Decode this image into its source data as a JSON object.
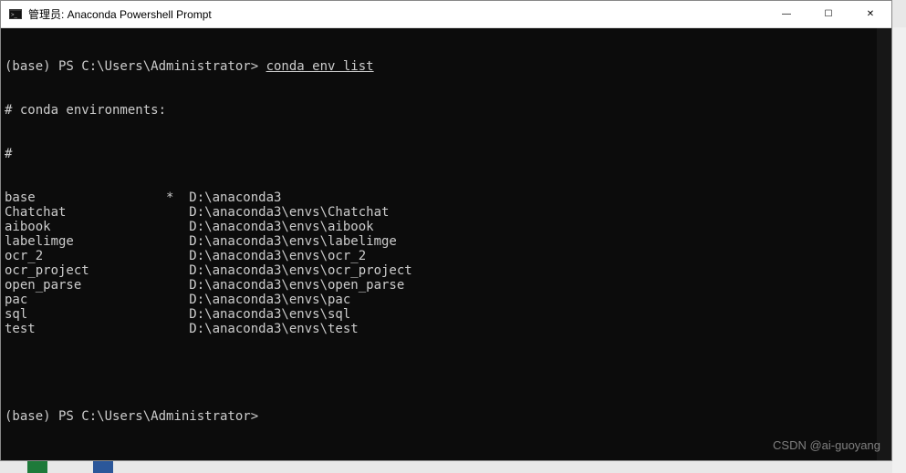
{
  "window": {
    "title": "管理员: Anaconda Powershell Prompt",
    "controls": {
      "minimize": "—",
      "maximize": "☐",
      "close": "✕"
    }
  },
  "terminal": {
    "prompt1_prefix": "(base) PS C:\\Users\\Administrator> ",
    "command": "conda env list",
    "header1": "# conda environments:",
    "header2": "#",
    "environments": [
      {
        "name": "base",
        "active": "*",
        "path": "D:\\anaconda3"
      },
      {
        "name": "Chatchat",
        "active": " ",
        "path": "D:\\anaconda3\\envs\\Chatchat"
      },
      {
        "name": "aibook",
        "active": " ",
        "path": "D:\\anaconda3\\envs\\aibook"
      },
      {
        "name": "labelimge",
        "active": " ",
        "path": "D:\\anaconda3\\envs\\labelimge"
      },
      {
        "name": "ocr_2",
        "active": " ",
        "path": "D:\\anaconda3\\envs\\ocr_2"
      },
      {
        "name": "ocr_project",
        "active": " ",
        "path": "D:\\anaconda3\\envs\\ocr_project"
      },
      {
        "name": "open_parse",
        "active": " ",
        "path": "D:\\anaconda3\\envs\\open_parse"
      },
      {
        "name": "pac",
        "active": " ",
        "path": "D:\\anaconda3\\envs\\pac"
      },
      {
        "name": "sql",
        "active": " ",
        "path": "D:\\anaconda3\\envs\\sql"
      },
      {
        "name": "test",
        "active": " ",
        "path": "D:\\anaconda3\\envs\\test"
      }
    ],
    "prompt2": "(base) PS C:\\Users\\Administrator>"
  },
  "watermark": "CSDN @ai-guoyang"
}
